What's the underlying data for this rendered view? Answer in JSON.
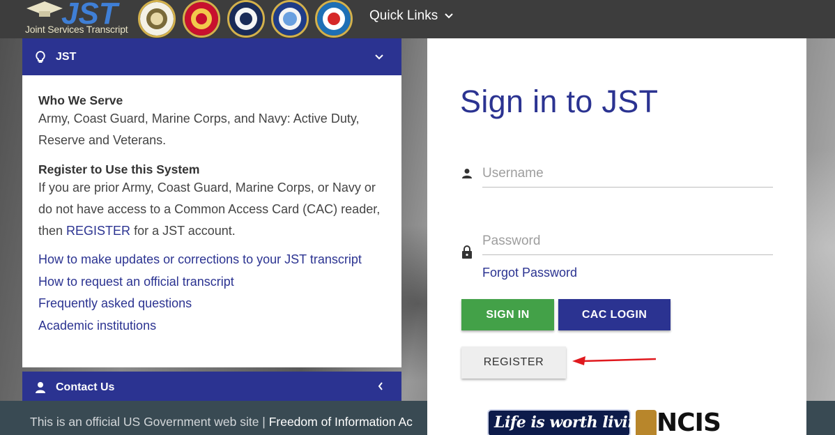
{
  "header": {
    "logo_text": "JST",
    "logo_subtitle": "Joint Services Transcript",
    "seals": [
      "army-seal-icon",
      "marine-corps-seal-icon",
      "navy-seal-icon",
      "air-force-seal-icon",
      "coast-guard-seal-icon"
    ],
    "quick_links_label": "Quick Links"
  },
  "sidebar": {
    "jst_header": "JST",
    "who_we_serve_title": "Who We Serve",
    "who_we_serve_text": "Army, Coast Guard, Marine Corps, and Navy: Active Duty, Reserve and Veterans.",
    "register_title": "Register to Use this System",
    "register_text_before": "If you are prior Army, Coast Guard, Marine Corps, or Navy or do not have access to a Common Access Card (CAC) reader, then ",
    "register_link": "REGISTER",
    "register_text_after": " for a JST account.",
    "links": [
      "How to make updates or corrections to your JST transcript",
      "How to request an official transcript",
      "Frequently asked questions",
      "Academic institutions"
    ],
    "contact_header": "Contact Us"
  },
  "signin": {
    "title": "Sign in to JST",
    "username_placeholder": "Username",
    "password_placeholder": "Password",
    "forgot_password": "Forgot Password",
    "signin_button": "SIGN IN",
    "cac_button": "CAC LOGIN",
    "register_button": "REGISTER"
  },
  "badges": {
    "life_text": "Life is worth living!",
    "ncis_text": "NCIS"
  },
  "footer": {
    "text": "This is an official US Government web site | ",
    "foia_link": "Freedom of Information Ac"
  },
  "colors": {
    "primary": "#2b3391",
    "success": "#43a148",
    "header_bg": "#3d3d3d",
    "footer_bg": "#394a53",
    "arrow": "#e0191e"
  }
}
